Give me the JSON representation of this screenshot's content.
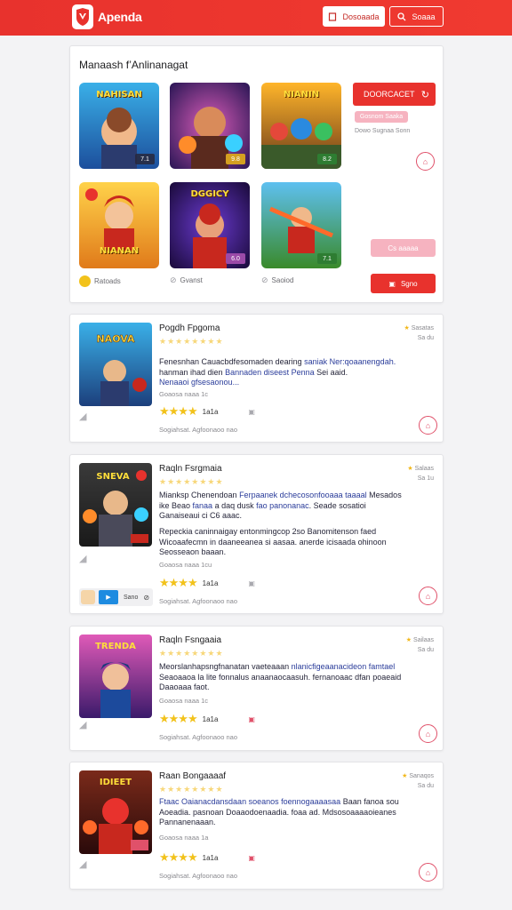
{
  "header": {
    "brand": "Apenda",
    "button_primary": "Dosoaada",
    "button_secondary": "Soaaa"
  },
  "featured": {
    "title": "Manaash f’Anlinanagat",
    "primary_button": "DOORCACET",
    "tag": "Gosnom Saaka",
    "note": "Dowo Sugnaa Sonn",
    "pink_button": "Cs aaaaa",
    "red_button": "Sgno",
    "meta": [
      "Ratoads",
      "Gvanst",
      "Saoiod"
    ],
    "thumbs": [
      {
        "title": "NAHISAN",
        "badge": "7.1"
      },
      {
        "title": "",
        "badge": "9.8"
      },
      {
        "title": "NIANIN",
        "badge": "8.2"
      },
      {
        "title": "NIANAN",
        "badge": ""
      },
      {
        "title": "DGGICY",
        "badge": "6.0"
      },
      {
        "title": "",
        "badge": "7.1"
      }
    ]
  },
  "list": [
    {
      "title": "Pogdh Fpgoma",
      "rank_line1": "Sasatas",
      "rank_line2": "Sa du",
      "desc_parts": [
        {
          "t": "Fenesnhan Cauacbdfesomaden dearing ",
          "blue": false
        },
        {
          "t": "saniak Ner:qoaanengdah.",
          "blue": true
        },
        {
          "t": " hanman ihad dien ",
          "blue": false
        },
        {
          "t": "Bannaden diseest Penna",
          "blue": true
        },
        {
          "t": " Sei aaid.",
          "blue": false
        },
        {
          "t": " Nenaaoi gfsesaonou...",
          "blue": true
        }
      ],
      "tag_line": "Goaosa naaa 1c",
      "rating_count": "1a1a",
      "footnote": "Sogiahsat. Agfoonaoo nao"
    },
    {
      "title": "Raqln Fsrgmaia",
      "rank_line1": "Salaas",
      "rank_line2": "Sa 1u",
      "desc_parts": [
        {
          "t": "Mianksp Chenendoan ",
          "blue": false
        },
        {
          "t": "Ferpaanek dchecosonfooaaa taaaal",
          "blue": true
        },
        {
          "t": " Mesados ike Beao ",
          "blue": false
        },
        {
          "t": "fanaa",
          "blue": true
        },
        {
          "t": " a daq dusk ",
          "blue": false
        },
        {
          "t": "fao panonanac",
          "blue": true
        },
        {
          "t": ". Seade sosatioi Ganaiseaui ci C6 aaac.",
          "blue": false
        }
      ],
      "desc2": "Repeckia caninnaigay entonmingcop 2so Banomitenson faed Wicoaafecmn in daaneeanea si aasaa. anerde icisaada ohinoon Seosseaon baaan.",
      "tag_line": "Goaosa naaa 1cu",
      "rating_count": "1a1a",
      "footnote": "Sogiahsat. Agfoonaoo nao",
      "chip_label": "Sano"
    },
    {
      "title": "Raqln Fsngaaia",
      "rank_line1": "Sailaas",
      "rank_line2": "Sa du",
      "desc_parts": [
        {
          "t": "Meorslanhapsngfnanatan vaeteaaan ",
          "blue": false
        },
        {
          "t": "nlanicfigeaanacideon famtael",
          "blue": true
        },
        {
          "t": " Seaoaaoa la lite fonnalus anaanaocaasuh. fernanoaac dfan poaeaid Daaoaaa faot.",
          "blue": false
        }
      ],
      "tag_line": "Goaosa naaa 1c",
      "rating_count": "1a1a",
      "footnote": "Sogiahsat. Agfoonaoo nao"
    },
    {
      "title": "Raan Bongaaaaf",
      "rank_line1": "Sanaqos",
      "rank_line2": "Sa du",
      "desc_parts": [
        {
          "t": "Ftaac Oaianacdansdaan soeanos ",
          "blue": true
        },
        {
          "t": "foennogaaaasaa",
          "blue": true
        },
        {
          "t": " Baan fanoa sou Aoeadia. pasnoan Doaaodoenaadia. foaa ad. Mdsosoaaaaoieanes Pannanenaaan.",
          "blue": false
        }
      ],
      "tag_line": "Goaosa naaa 1a",
      "rating_count": "1a1a",
      "footnote": "Sogiahsat. Agfoonaoo nao"
    }
  ],
  "colors": {
    "brand_red": "#e8322d",
    "pink": "#f6b3c0",
    "star": "#f2c21b",
    "link_blue": "#2a3c9a"
  }
}
